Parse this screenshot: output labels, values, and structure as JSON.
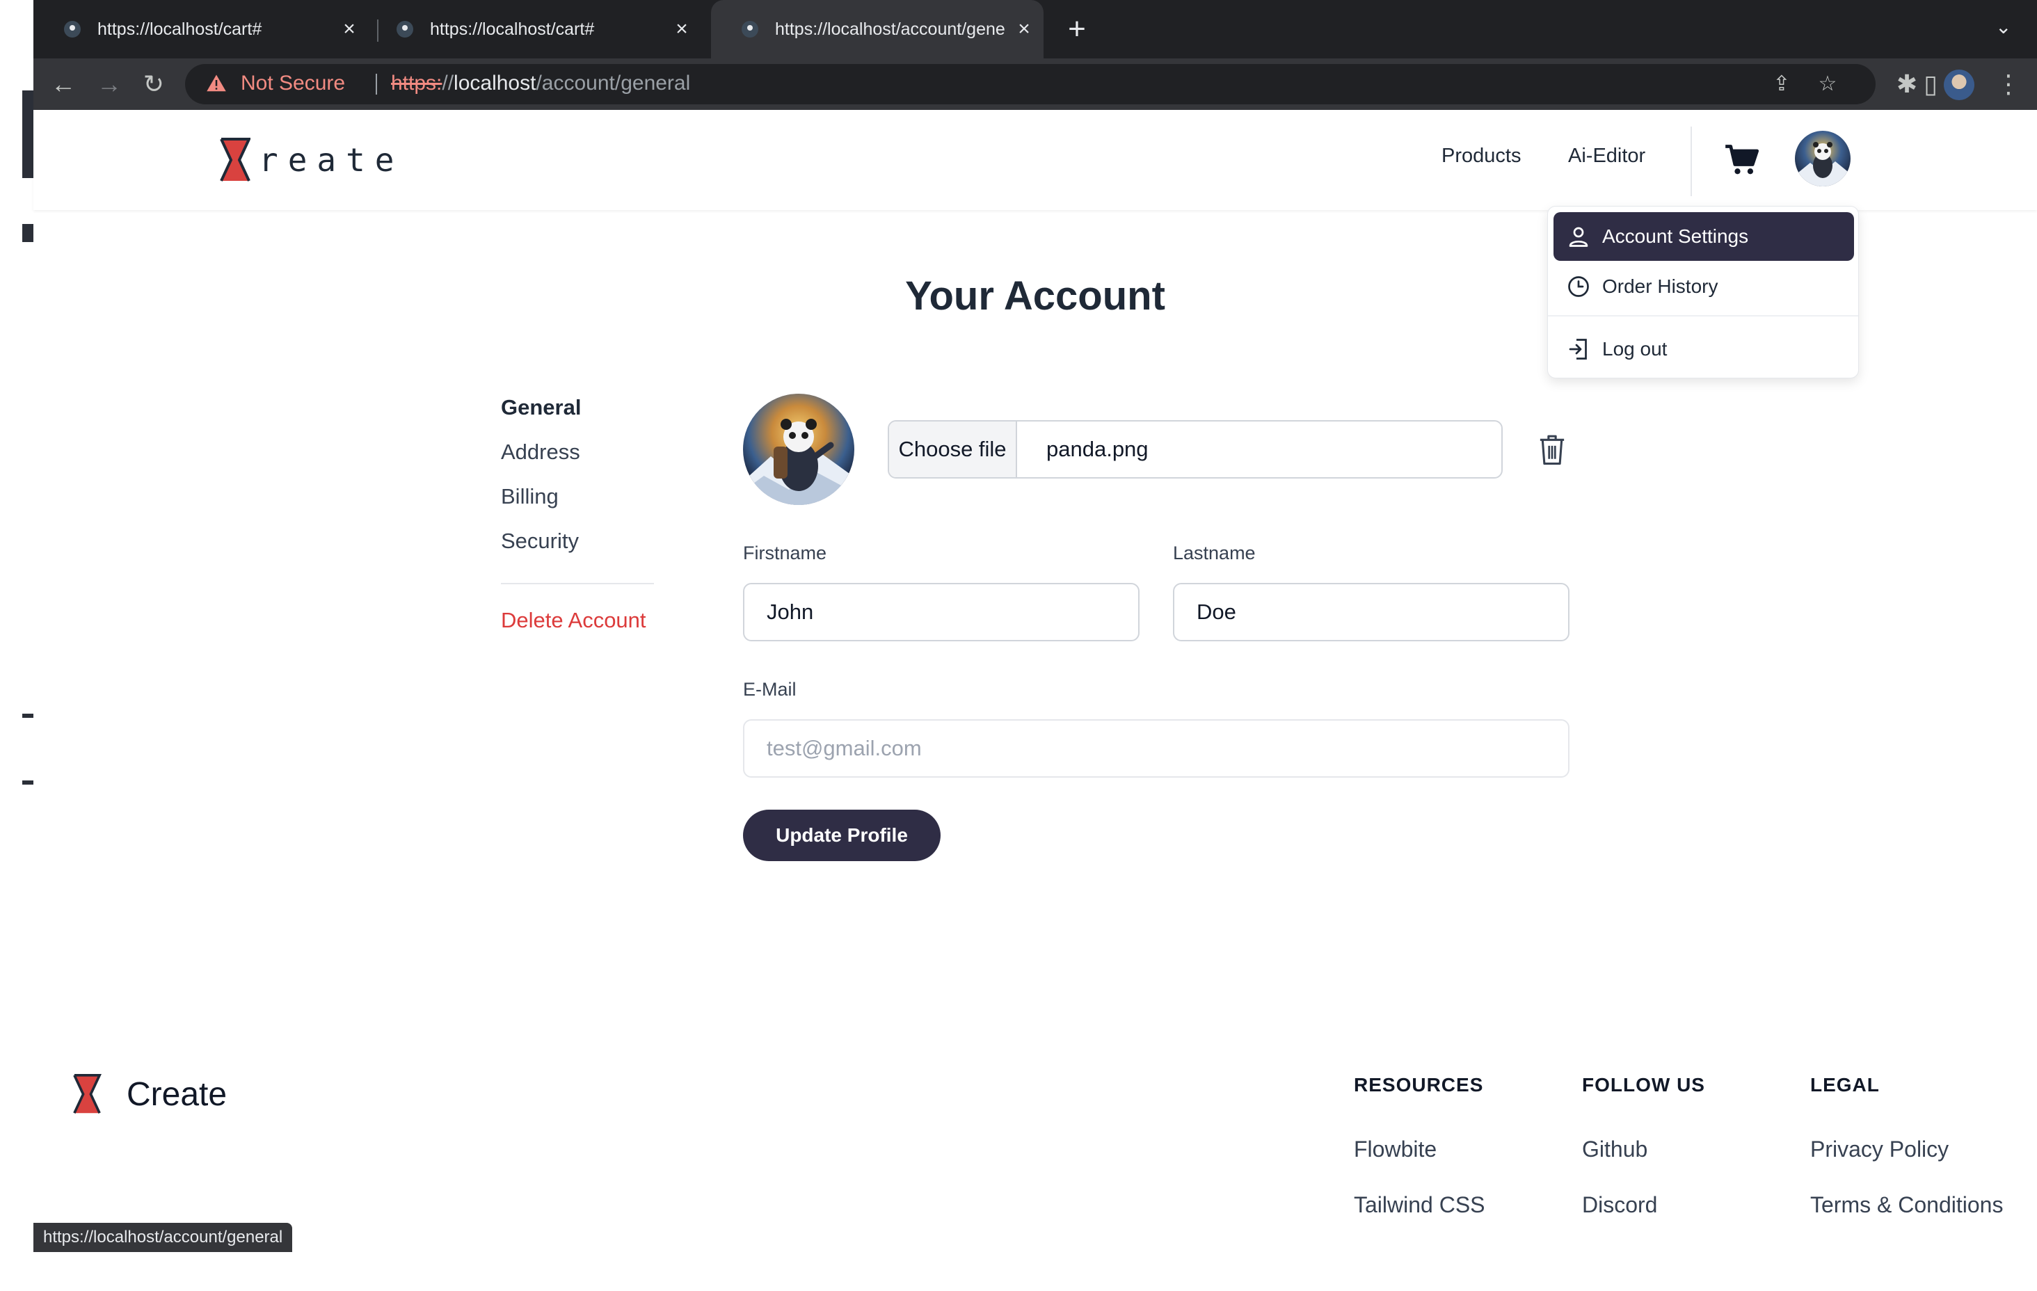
{
  "browser": {
    "tabs": [
      {
        "title": "https://localhost/cart#"
      },
      {
        "title": "https://localhost/cart#"
      },
      {
        "title": "https://localhost/account/gene"
      }
    ],
    "security_label": "Not Secure",
    "url": {
      "scheme": "https:",
      "rest_start": "//",
      "host": "localhost",
      "path": "/account/general"
    },
    "status_bubble": "https://localhost/account/general"
  },
  "header": {
    "logo_text": "reate",
    "nav": [
      "Products",
      "Ai-Editor"
    ]
  },
  "dropdown": {
    "items": [
      "Account Settings",
      "Order History",
      "Log out"
    ]
  },
  "page": {
    "title": "Your Account",
    "sidebar": [
      "General",
      "Address",
      "Billing",
      "Security"
    ],
    "delete_label": "Delete Account",
    "file": {
      "button": "Choose file",
      "name": "panda.png"
    },
    "firstname": {
      "label": "Firstname",
      "value": "John"
    },
    "lastname": {
      "label": "Lastname",
      "value": "Doe"
    },
    "email": {
      "label": "E-Mail",
      "placeholder": "test@gmail.com"
    },
    "update_label": "Update Profile"
  },
  "footer": {
    "brand": "Create",
    "columns": [
      {
        "heading": "RESOURCES",
        "links": [
          "Flowbite",
          "Tailwind CSS"
        ]
      },
      {
        "heading": "FOLLOW US",
        "links": [
          "Github",
          "Discord"
        ]
      },
      {
        "heading": "LEGAL",
        "links": [
          "Privacy Policy",
          "Terms & Conditions"
        ]
      }
    ]
  },
  "colors": {
    "accent": "#2f2d45",
    "danger": "#dc3b3b",
    "logo_red": "#d9423f"
  }
}
